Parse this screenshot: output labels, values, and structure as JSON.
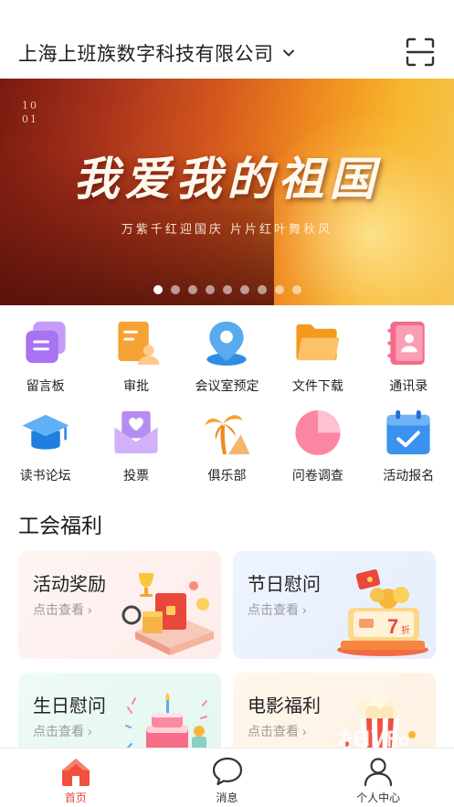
{
  "header": {
    "company_name": "上海上班族数字科技有限公司",
    "dropdown_icon": "chevron-down-icon",
    "scan_icon": "scan-icon"
  },
  "banner": {
    "date_line1": "10",
    "date_line2": "01",
    "title": "我爱我的祖国",
    "subtitle": "万紫千红迎国庆 片片红叶舞秋风",
    "page_count": 9,
    "active_index": 0
  },
  "grid": [
    {
      "label": "留言板",
      "icon": "message-board-icon"
    },
    {
      "label": "审批",
      "icon": "approval-icon"
    },
    {
      "label": "会议室预定",
      "icon": "location-pin-icon"
    },
    {
      "label": "文件下载",
      "icon": "folder-icon"
    },
    {
      "label": "通讯录",
      "icon": "contacts-icon"
    },
    {
      "label": "读书论坛",
      "icon": "graduation-cap-icon"
    },
    {
      "label": "投票",
      "icon": "vote-envelope-icon"
    },
    {
      "label": "俱乐部",
      "icon": "palm-tree-icon"
    },
    {
      "label": "问卷调查",
      "icon": "pie-chart-icon"
    },
    {
      "label": "活动报名",
      "icon": "calendar-check-icon"
    }
  ],
  "section": {
    "title": "工会福利"
  },
  "cards": [
    {
      "title": "活动奖励",
      "link": "点击查看 ›"
    },
    {
      "title": "节日慰问",
      "link": "点击查看 ›",
      "coupon_number": "7",
      "coupon_unit": "折"
    },
    {
      "title": "生日慰问",
      "link": "点击查看 ›"
    },
    {
      "title": "电影福利",
      "link": "点击查看 ›"
    }
  ],
  "tabbar": [
    {
      "label": "首页",
      "icon": "home-icon",
      "active": true
    },
    {
      "label": "消息",
      "icon": "chat-bubble-icon",
      "active": false
    },
    {
      "label": "个人中心",
      "icon": "person-icon",
      "active": false
    }
  ],
  "colors": {
    "accent": "#e8483a",
    "text": "#222222",
    "muted": "#9a9a9a"
  }
}
